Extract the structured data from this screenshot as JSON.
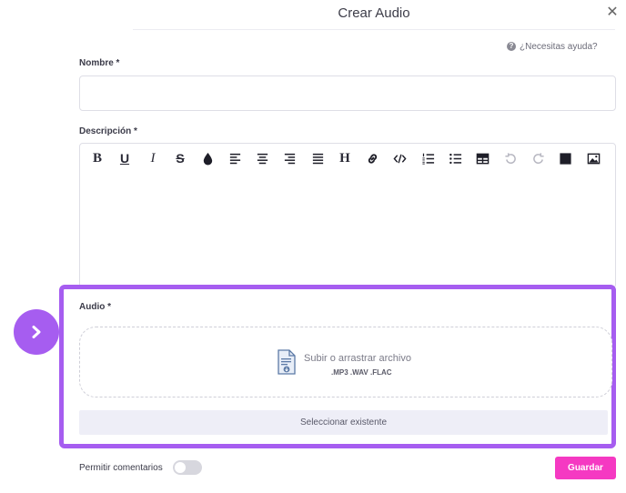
{
  "header": {
    "title": "Crear Audio",
    "close_symbol": "✕"
  },
  "help": {
    "label": "¿Necesitas ayuda?",
    "icon": "question-circle-icon"
  },
  "fields": {
    "name": {
      "label": "Nombre *",
      "value": "",
      "placeholder": ""
    },
    "description": {
      "label": "Descripción *",
      "toolbar": [
        "bold",
        "underline",
        "italic",
        "strikethrough",
        "text-color",
        "align-left",
        "align-center",
        "align-right",
        "align-justify",
        "heading",
        "link",
        "code",
        "ordered-list",
        "unordered-list",
        "table",
        "undo",
        "redo",
        "color-swatch",
        "image"
      ]
    },
    "audio": {
      "label": "Audio *",
      "dropzone_title": "Subir o arrastrar archivo",
      "dropzone_formats": ".MP3 .WAV .FLAC",
      "select_existing": "Seleccionar existente"
    }
  },
  "footer": {
    "comments_label": "Permitir comentarios",
    "comments_enabled": false,
    "save_label": "Guardar"
  },
  "colors": {
    "highlight": "#a65df0",
    "save_button": "#f539c2",
    "select_existing_bg": "#eeeef7"
  }
}
